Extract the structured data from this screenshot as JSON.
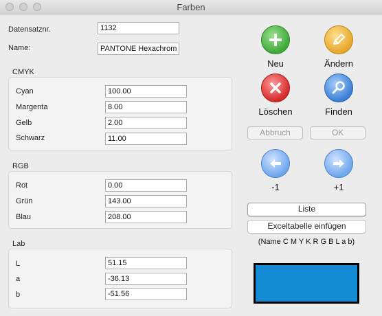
{
  "window": {
    "title": "Farben"
  },
  "record": {
    "id_label": "Datensatznr.",
    "id_value": "1132",
    "name_label": "Name:",
    "name_value": "PANTONE Hexachrom"
  },
  "cmyk": {
    "title": "CMYK",
    "fields": [
      {
        "label": "Cyan",
        "value": "100.00"
      },
      {
        "label": "Margenta",
        "value": "8.00"
      },
      {
        "label": "Gelb",
        "value": "2.00"
      },
      {
        "label": "Schwarz",
        "value": "11.00"
      }
    ]
  },
  "rgb": {
    "title": "RGB",
    "fields": [
      {
        "label": "Rot",
        "value": "0.00"
      },
      {
        "label": "Grün",
        "value": "143.00"
      },
      {
        "label": "Blau",
        "value": "208.00"
      }
    ]
  },
  "lab": {
    "title": "Lab",
    "fields": [
      {
        "label": "L",
        "value": "51.15"
      },
      {
        "label": "a",
        "value": "-36.13"
      },
      {
        "label": "b",
        "value": "-51.56"
      }
    ]
  },
  "actions": {
    "new_label": "Neu",
    "edit_label": "Ändern",
    "delete_label": "Löschen",
    "find_label": "Finden",
    "cancel_label": "Abbruch",
    "ok_label": "OK",
    "prev_label": "-1",
    "next_label": "+1",
    "list_label": "Liste",
    "excel_label": "Exceltabelle einfügen",
    "excel_note": "(Name C M Y K R G B L a b)"
  },
  "icons": {
    "new": "plus-icon",
    "edit": "pencil-icon",
    "delete": "delete-x-icon",
    "find": "magnifier-icon",
    "prev": "arrow-left-icon",
    "next": "arrow-right-icon"
  },
  "colors": {
    "preview": "#128ad4",
    "green": "#3fa83a",
    "orange": "#e7a62a",
    "red": "#d42a2a",
    "blue": "#3b7fd6"
  }
}
